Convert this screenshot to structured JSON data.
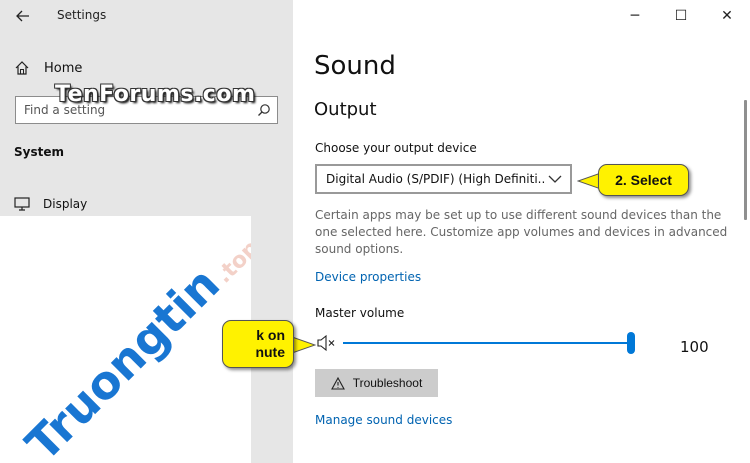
{
  "window": {
    "title": "Settings",
    "back_icon": "arrow-left-icon",
    "controls": {
      "minimize": "─",
      "maximize": "☐",
      "close": "✕"
    }
  },
  "nav": {
    "home_label": "Home",
    "search_placeholder": "Find a setting",
    "section_label": "System",
    "display_label": "Display"
  },
  "watermarks": {
    "tenforums": "TenForums.com",
    "truongtin": "Truongtin",
    "truongtin_suffix": ".top"
  },
  "main": {
    "title": "Sound",
    "output_heading": "Output",
    "choose_label": "Choose your output device",
    "selected_device": "Digital Audio (S/PDIF) (High Definiti...",
    "description": "Certain apps may be set up to use different sound devices than the one selected here. Customize app volumes and devices in advanced sound options.",
    "device_properties_link": "Device properties",
    "master_volume_label": "Master volume",
    "volume_value": "100",
    "volume_level": 1.0,
    "troubleshoot_label": "Troubleshoot",
    "manage_devices_link": "Manage sound devices"
  },
  "callouts": {
    "select": "2. Select",
    "mute_line1": "k on",
    "mute_line2": "nute"
  },
  "colors": {
    "accent": "#0078d7",
    "link": "#0063b1",
    "nav_bg": "#e6e6e6",
    "callout_bg": "#fff200"
  }
}
